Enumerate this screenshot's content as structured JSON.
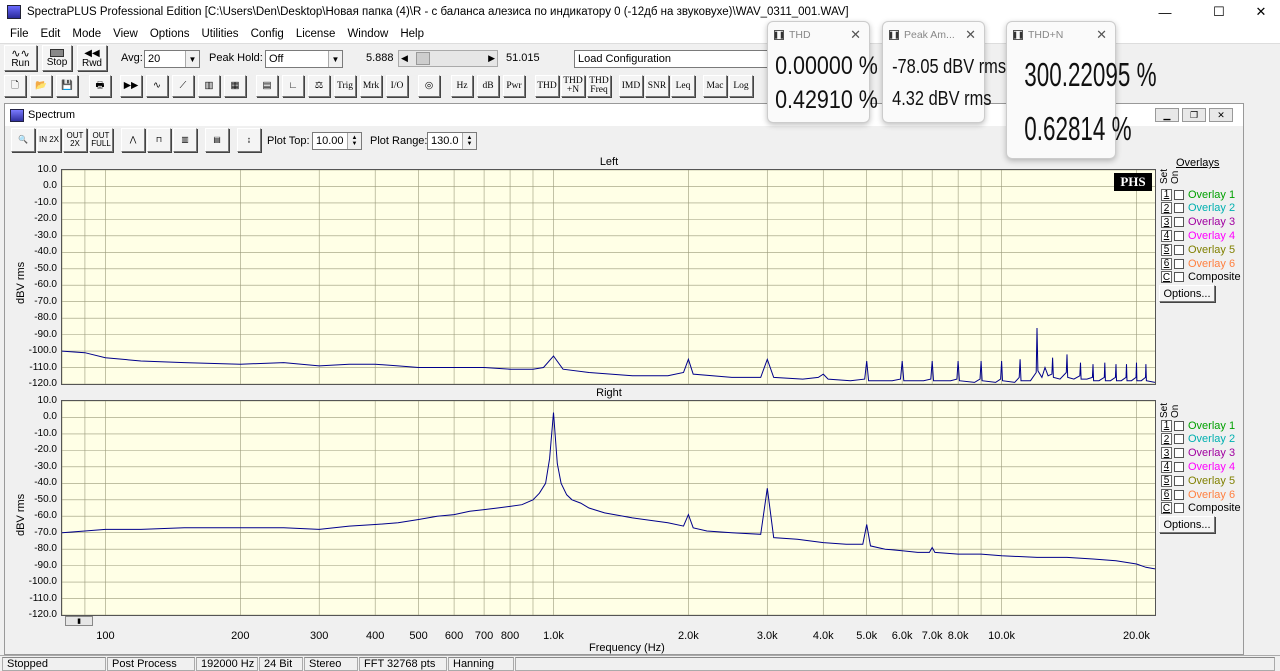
{
  "window": {
    "title": "SpectraPLUS Professional Edition [C:\\Users\\Den\\Desktop\\Новая папка (4)\\R - с баланса алезиса по индикатору 0 (-12дб на звуковухе)\\WAV_0311_001.WAV]",
    "minimize": "—",
    "maximize": "☐",
    "close": "✕"
  },
  "menu": [
    "File",
    "Edit",
    "Mode",
    "View",
    "Options",
    "Utilities",
    "Config",
    "License",
    "Window",
    "Help"
  ],
  "toolbar": {
    "run_label": "Run",
    "stop_label": "Stop",
    "rwd_label": "Rwd",
    "avg_label": "Avg:",
    "avg_value": "20",
    "peak_hold_label": "Peak Hold:",
    "peak_hold_value": "Off",
    "pos_left": "5.888",
    "pos_right": "51.015",
    "config_value": "Load Configuration",
    "scroll_fraction": 0.05,
    "buttons": [
      "Trig",
      "Mrk",
      "I/O",
      "Hz",
      "dB",
      "Pwr",
      "THD",
      "THD +N",
      "THD Freq",
      "IMD",
      "SNR",
      "Leq",
      "Mac",
      "Log"
    ]
  },
  "spectrum": {
    "title": "Spectrum",
    "tool_labels": [
      "IN 2X",
      "OUT 2X",
      "OUT FULL"
    ],
    "plot_top_label": "Plot Top:",
    "plot_top_value": "10.00",
    "plot_range_label": "Plot Range:",
    "plot_range_value": "130.0",
    "phs_logo": "PHS",
    "overlays_title": "Overlays",
    "set_label": "Set",
    "on_label": "On",
    "options_label": "Options...",
    "overlays": [
      {
        "num": "1",
        "name": "Overlay 1",
        "color": "#00a000"
      },
      {
        "num": "2",
        "name": "Overlay 2",
        "color": "#00b0b0"
      },
      {
        "num": "3",
        "name": "Overlay 3",
        "color": "#a000a0"
      },
      {
        "num": "4",
        "name": "Overlay 4",
        "color": "#ff00ff"
      },
      {
        "num": "5",
        "name": "Overlay 5",
        "color": "#808000"
      },
      {
        "num": "6",
        "name": "Overlay 6",
        "color": "#ff8040"
      },
      {
        "num": "C",
        "name": "Composite",
        "color": "#000000"
      }
    ]
  },
  "chart_data": [
    {
      "type": "line",
      "title": "Left",
      "xlabel": "Frequency (Hz)",
      "ylabel": "dBV rms",
      "xscale": "log",
      "xlim": [
        80,
        22000
      ],
      "ylim": [
        -120,
        10
      ],
      "grid": true,
      "line_color": "#00008b",
      "xticks": [
        "100",
        "200",
        "300",
        "400",
        "500",
        "600",
        "700",
        "800",
        "1.0k",
        "2.0k",
        "3.0k",
        "4.0k",
        "5.0k",
        "6.0k",
        "7.0k",
        "8.0k",
        "10.0k",
        "20.0k"
      ],
      "xtick_values": [
        100,
        200,
        300,
        400,
        500,
        600,
        700,
        800,
        1000,
        2000,
        3000,
        4000,
        5000,
        6000,
        7000,
        8000,
        10000,
        20000
      ],
      "yticks": [
        "10.0",
        "0.0",
        "-10.0",
        "-20.0",
        "-30.0",
        "-40.0",
        "-50.0",
        "-60.0",
        "-70.0",
        "-80.0",
        "-90.0",
        "-100.0",
        "-110.0",
        "-120.0"
      ],
      "ytick_values": [
        10,
        0,
        -10,
        -20,
        -30,
        -40,
        -50,
        -60,
        -70,
        -80,
        -90,
        -100,
        -110,
        -120
      ],
      "series": [
        {
          "x": [
            80,
            90,
            100,
            120,
            150,
            200,
            250,
            300,
            350,
            400,
            450,
            500,
            600,
            700,
            800,
            900,
            950,
            1000,
            1050,
            1200,
            1500,
            1800,
            1950,
            2000,
            2050,
            2500,
            2900,
            3000,
            3100,
            3600,
            3900,
            4000,
            4100,
            4600,
            4950,
            5000,
            5050,
            5700,
            5950,
            6000,
            6050,
            6700,
            6950,
            7000,
            7050,
            7700,
            7950,
            8000,
            8050,
            8700,
            8950,
            9000,
            9050,
            9700,
            9950,
            10000,
            10050,
            10700,
            10950,
            11000,
            11050,
            11600,
            11950,
            12000,
            12050,
            12300,
            12500,
            12700,
            12950,
            13000,
            13050,
            13500,
            13950,
            14000,
            14050,
            14500,
            14950,
            15000,
            15050,
            15500,
            15950,
            16000,
            16050,
            16500,
            16950,
            17000,
            17050,
            17500,
            17950,
            18000,
            18050,
            18500,
            18950,
            19000,
            19050,
            19500,
            19950,
            20000,
            20050,
            20500,
            20950,
            21000,
            21050,
            22000
          ],
          "y": [
            -100,
            -101,
            -104,
            -106,
            -107,
            -108,
            -107,
            -109,
            -108,
            -108,
            -109,
            -110,
            -110,
            -110,
            -111,
            -111,
            -110,
            -103,
            -111,
            -113,
            -115,
            -115,
            -113,
            -105,
            -114,
            -116,
            -116,
            -105,
            -116,
            -117,
            -116,
            -114,
            -117,
            -118,
            -117,
            -106,
            -118,
            -118,
            -117,
            -106,
            -118,
            -118,
            -117,
            -106,
            -118,
            -118,
            -117,
            -106,
            -118,
            -119,
            -117,
            -106,
            -118,
            -119,
            -117,
            -106,
            -118,
            -119,
            -116,
            -105,
            -118,
            -118,
            -113,
            -86,
            -112,
            -116,
            -110,
            -115,
            -114,
            -104,
            -116,
            -117,
            -113,
            -102,
            -116,
            -117,
            -115,
            -107,
            -117,
            -117,
            -116,
            -108,
            -118,
            -118,
            -116,
            -107,
            -118,
            -118,
            -116,
            -108,
            -118,
            -118,
            -116,
            -108,
            -118,
            -118,
            -116,
            -107,
            -118,
            -118,
            -116,
            -108,
            -118,
            -119
          ]
        }
      ]
    },
    {
      "type": "line",
      "title": "Right",
      "xlabel": "Frequency (Hz)",
      "ylabel": "dBV rms",
      "xscale": "log",
      "xlim": [
        80,
        22000
      ],
      "ylim": [
        -120,
        10
      ],
      "grid": true,
      "line_color": "#00008b",
      "xticks": [
        "100",
        "200",
        "300",
        "400",
        "500",
        "600",
        "700",
        "800",
        "1.0k",
        "2.0k",
        "3.0k",
        "4.0k",
        "5.0k",
        "6.0k",
        "7.0k",
        "8.0k",
        "10.0k",
        "20.0k"
      ],
      "xtick_values": [
        100,
        200,
        300,
        400,
        500,
        600,
        700,
        800,
        1000,
        2000,
        3000,
        4000,
        5000,
        6000,
        7000,
        8000,
        10000,
        20000
      ],
      "yticks": [
        "10.0",
        "0.0",
        "-10.0",
        "-20.0",
        "-30.0",
        "-40.0",
        "-50.0",
        "-60.0",
        "-70.0",
        "-80.0",
        "-90.0",
        "-100.0",
        "-110.0",
        "-120.0"
      ],
      "ytick_values": [
        10,
        0,
        -10,
        -20,
        -30,
        -40,
        -50,
        -60,
        -70,
        -80,
        -90,
        -100,
        -110,
        -120
      ],
      "series": [
        {
          "x": [
            80,
            90,
            100,
            120,
            150,
            200,
            250,
            300,
            350,
            400,
            450,
            500,
            550,
            600,
            650,
            700,
            750,
            800,
            850,
            900,
            930,
            960,
            980,
            1000,
            1020,
            1040,
            1070,
            1100,
            1150,
            1200,
            1300,
            1500,
            1800,
            1950,
            2000,
            2050,
            2200,
            2500,
            2900,
            3000,
            3100,
            3500,
            4000,
            4500,
            4900,
            5000,
            5100,
            5500,
            6000,
            6500,
            6900,
            7000,
            7100,
            8000,
            9000,
            10000,
            12000,
            14000,
            16000,
            18000,
            20000,
            21000,
            22000
          ],
          "y": [
            -70,
            -69,
            -68,
            -68,
            -67,
            -67,
            -67,
            -68,
            -66,
            -65,
            -64,
            -62,
            -60,
            -59,
            -57,
            -56,
            -55,
            -54,
            -53,
            -50,
            -46,
            -40,
            -25,
            3,
            -28,
            -40,
            -47,
            -50,
            -52,
            -55,
            -58,
            -61,
            -64,
            -66,
            -59,
            -67,
            -69,
            -70,
            -71,
            -43,
            -73,
            -74,
            -76,
            -77,
            -77,
            -65,
            -78,
            -80,
            -81,
            -82,
            -82,
            -79,
            -82,
            -83,
            -83,
            -84,
            -85,
            -85,
            -86,
            -87,
            -89,
            -91,
            -92
          ]
        }
      ]
    }
  ],
  "meters": [
    {
      "title": "THD",
      "values": [
        "0.00000 %",
        "0.42910 %"
      ]
    },
    {
      "title": "Peak Am...",
      "values": [
        "-78.05 dBV rms",
        "4.32 dBV rms"
      ]
    },
    {
      "title": "THD+N",
      "values": [
        "300.22095 %",
        "0.62814 %"
      ]
    }
  ],
  "status": [
    "Stopped",
    "Post Process",
    "192000 Hz",
    "24 Bit",
    "Stereo",
    "FFT 32768 pts",
    "Hanning"
  ]
}
